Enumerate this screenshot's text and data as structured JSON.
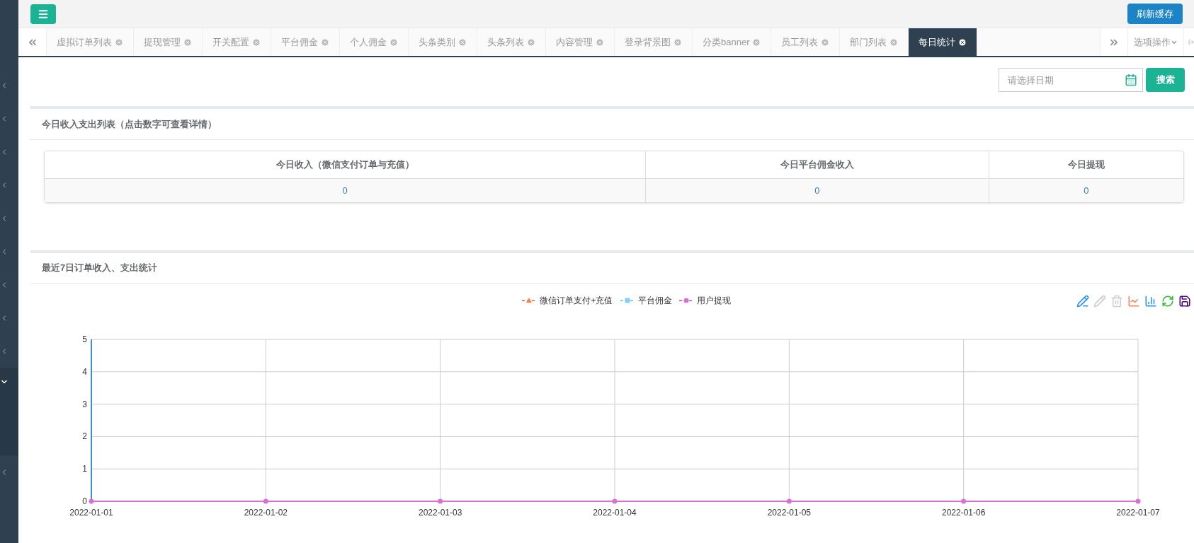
{
  "sidebar": {
    "items": [
      {
        "selected": false
      },
      {
        "selected": false
      },
      {
        "selected": false
      },
      {
        "selected": false
      },
      {
        "selected": false
      },
      {
        "selected": false
      },
      {
        "selected": false
      },
      {
        "selected": false
      },
      {
        "selected": false
      },
      {
        "selected": true
      },
      {
        "selected": false
      }
    ]
  },
  "header": {
    "refresh_button": "刷新缓存"
  },
  "tab_nav": {
    "tabs": [
      {
        "label": "虚拟订单列表",
        "selected": false
      },
      {
        "label": "提现管理",
        "selected": false
      },
      {
        "label": "开关配置",
        "selected": false
      },
      {
        "label": "平台佣金",
        "selected": false
      },
      {
        "label": "个人佣金",
        "selected": false
      },
      {
        "label": "头条类别",
        "selected": false
      },
      {
        "label": "头条列表",
        "selected": false
      },
      {
        "label": "内容管理",
        "selected": false
      },
      {
        "label": "登录背景图",
        "selected": false
      },
      {
        "label": "分类banner",
        "selected": false
      },
      {
        "label": "员工列表",
        "selected": false
      },
      {
        "label": "部门列表",
        "selected": false
      },
      {
        "label": "每日统计",
        "selected": true
      }
    ],
    "options_menu": "选项操作"
  },
  "search": {
    "date_placeholder": "请选择日期",
    "button": "搜索"
  },
  "today_section": {
    "title": "今日收入支出列表（点击数字可查看详情）",
    "table": {
      "columns": [
        "今日收入（微信支付订单与充值）",
        "今日平台佣金收入",
        "今日提现"
      ],
      "rows": [
        [
          "0",
          "0",
          "0"
        ]
      ]
    }
  },
  "chart_section": {
    "title": "最近7日订单收入、支出统计",
    "chart_data": {
      "type": "line",
      "categories": [
        "2022-01-01",
        "2022-01-02",
        "2022-01-03",
        "2022-01-04",
        "2022-01-05",
        "2022-01-06",
        "2022-01-07"
      ],
      "series": [
        {
          "name": "微信订单支付+充值",
          "color": "#ff7f50",
          "marker": "triangle",
          "values": [
            null,
            null,
            null,
            null,
            null,
            null,
            null
          ]
        },
        {
          "name": "平台佣金",
          "color": "#87cefa",
          "marker": "square",
          "values": [
            null,
            null,
            null,
            null,
            null,
            null,
            null
          ]
        },
        {
          "name": "用户提现",
          "color": "#da70d6",
          "marker": "circle",
          "values": [
            0,
            0,
            0,
            0,
            0,
            0,
            0
          ]
        }
      ],
      "ylim": [
        0,
        5
      ],
      "yticks": [
        0,
        1,
        2,
        3,
        4,
        5
      ],
      "grid": true
    }
  }
}
